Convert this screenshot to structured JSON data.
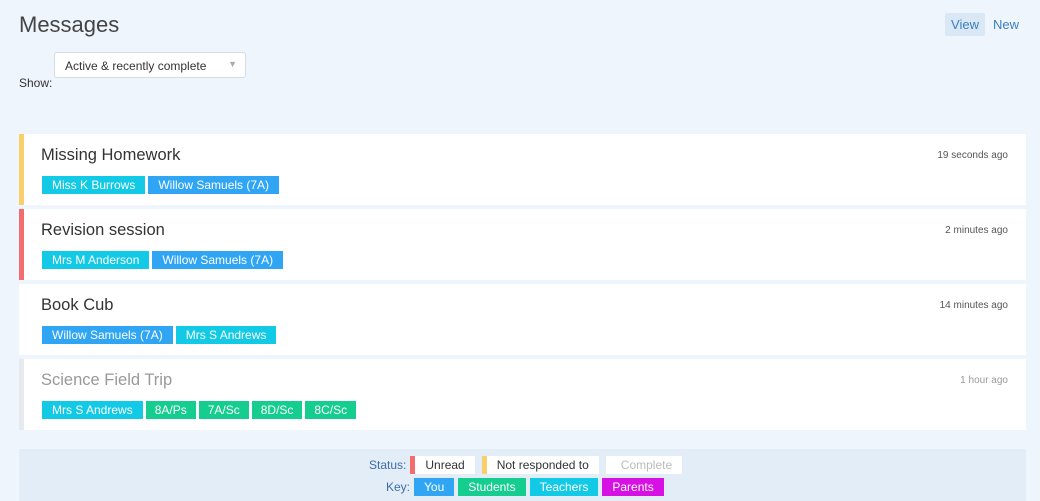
{
  "header": {
    "title": "Messages",
    "view_label": "View",
    "new_label": "New"
  },
  "filter": {
    "show_label": "Show:",
    "selected": "Active & recently complete"
  },
  "messages": [
    {
      "title": "Missing Homework",
      "time": "19 seconds ago",
      "status": "pending",
      "tags": [
        {
          "text": "Miss K Burrows",
          "kind": "teacher"
        },
        {
          "text": "Willow Samuels (7A)",
          "kind": "you"
        }
      ]
    },
    {
      "title": "Revision session",
      "time": "2 minutes ago",
      "status": "unread",
      "tags": [
        {
          "text": "Mrs M Anderson",
          "kind": "teacher"
        },
        {
          "text": "Willow Samuels (7A)",
          "kind": "you"
        }
      ]
    },
    {
      "title": "Book Cub",
      "time": "14 minutes ago",
      "status": "plain",
      "tags": [
        {
          "text": "Willow Samuels (7A)",
          "kind": "you"
        },
        {
          "text": "Mrs S Andrews",
          "kind": "teacher"
        }
      ]
    },
    {
      "title": "Science Field Trip",
      "time": "1 hour ago",
      "status": "complete",
      "tags": [
        {
          "text": "Mrs S Andrews",
          "kind": "teacher"
        },
        {
          "text": "8A/Ps",
          "kind": "student"
        },
        {
          "text": "7A/Sc",
          "kind": "student"
        },
        {
          "text": "8D/Sc",
          "kind": "student"
        },
        {
          "text": "8C/Sc",
          "kind": "student"
        }
      ]
    }
  ],
  "legend": {
    "status_label": "Status:",
    "statuses": [
      "Unread",
      "Not responded to",
      "Complete"
    ],
    "key_label": "Key:",
    "keys": [
      "You",
      "Students",
      "Teachers",
      "Parents"
    ]
  },
  "colors": {
    "unread": "#f26d6d",
    "pending": "#f8cf6a",
    "you": "#2fa5f4",
    "student": "#14cd8e",
    "teacher": "#12c9e6",
    "parent": "#d710e4"
  }
}
